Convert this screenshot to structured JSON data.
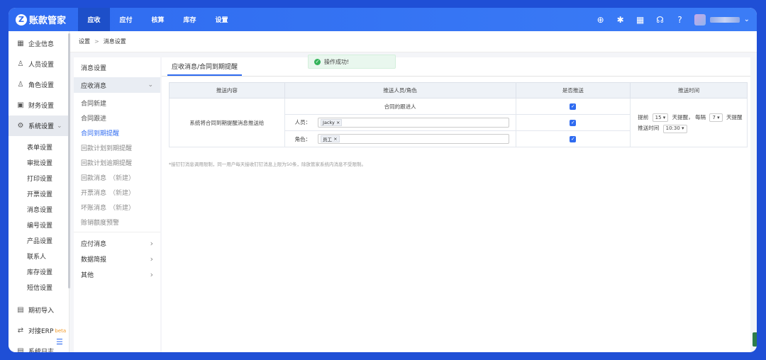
{
  "app": {
    "logo_mark": "Z",
    "name": "账款管家"
  },
  "topnav": [
    {
      "label": "应收",
      "active": true
    },
    {
      "label": "应付",
      "active": false
    },
    {
      "label": "核算",
      "active": false
    },
    {
      "label": "库存",
      "active": false
    },
    {
      "label": "设置",
      "active": false
    }
  ],
  "topicons": {
    "add": "⊕",
    "bug": "✱",
    "grid": "▦",
    "support": "☊",
    "help": "?",
    "caret": "⌄"
  },
  "sidebar": {
    "items": [
      {
        "label": "企业信息",
        "icon": "▦"
      },
      {
        "label": "人员设置",
        "icon": "♙"
      },
      {
        "label": "角色设置",
        "icon": "♙"
      },
      {
        "label": "财务设置",
        "icon": "▣"
      },
      {
        "label": "系统设置",
        "icon": "⚙",
        "caret": "⌄"
      }
    ],
    "sub_items": [
      "表单设置",
      "审批设置",
      "打印设置",
      "开票设置",
      "消息设置",
      "编号设置",
      "产品设置",
      "联系人",
      "库存设置",
      "短信设置"
    ],
    "bottom_items": [
      {
        "label": "期初导入",
        "icon": "▤"
      },
      {
        "label": "对接ERP",
        "icon": "⇄",
        "badge": "beta"
      },
      {
        "label": "系统日志",
        "icon": "▤"
      }
    ],
    "collapse_icon": "☰"
  },
  "breadcrumb": {
    "root": "设置",
    "separator": ">",
    "current": "消息设置"
  },
  "submenu": {
    "title": "消息设置",
    "open_group": {
      "label": "应收消息",
      "chevron": "⌄"
    },
    "items": [
      {
        "label": "合同新建",
        "extra": ""
      },
      {
        "label": "合同跟进",
        "extra": ""
      },
      {
        "label": "合同到期提醒",
        "extra": ""
      },
      {
        "label": "回款计划到期提醒",
        "extra": ""
      },
      {
        "label": "回款计划逾期提醒",
        "extra": ""
      },
      {
        "label": "回款消息",
        "extra": "（新建）"
      },
      {
        "label": "开票消息",
        "extra": "（新建）"
      },
      {
        "label": "坏账消息",
        "extra": "（新建）"
      },
      {
        "label": "赊销额度预警",
        "extra": ""
      }
    ],
    "groups": [
      {
        "label": "应付消息",
        "chevron": "›"
      },
      {
        "label": "数据简报",
        "chevron": "›"
      },
      {
        "label": "其他",
        "chevron": "›"
      }
    ]
  },
  "main": {
    "tab": "应收消息/合同到期提醒",
    "toast": {
      "icon": "✓",
      "text": "操作成功!"
    },
    "table": {
      "headers": [
        "推送内容",
        "推送人员/角色",
        "是否推送",
        "推送时间"
      ],
      "content_text": "系统将合同到期提醒消息推送给",
      "rows": [
        {
          "label": "合同的跟进人",
          "checked": true
        },
        {
          "label": "人员：",
          "tag": "Jacky",
          "checked": true
        },
        {
          "label": "角色：",
          "tag": "员工",
          "checked": true
        }
      ],
      "check_mark": "✓",
      "tag_close": "×",
      "time": {
        "prefix": "提前",
        "days_before": "15",
        "mid": "天提醒，",
        "every": "每隔",
        "interval": "7",
        "suffix": "天提醒",
        "push_time_label": "推送时间",
        "push_time": "10:30",
        "dropdown": "▾"
      }
    },
    "note": "*接钉钉消息调用限制，同一用户每天接收钉钉消息上限为50条，除放管家系统内消息不受限制。"
  }
}
